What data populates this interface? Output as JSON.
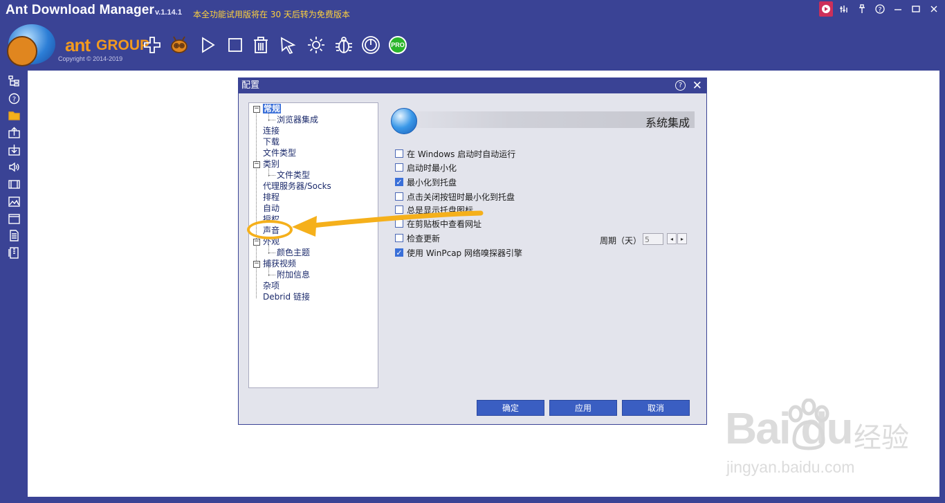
{
  "app": {
    "title": "Ant Download Manager",
    "version": "v.1.14.1",
    "trial_notice": "本全功能试用版将在 30 天后转为免费版本",
    "logo_word": "ant",
    "logo_group": "GROUP",
    "copyright": "Copyright © 2014-2019"
  },
  "window_controls": [
    "record-icon",
    "equalizer-icon",
    "pin-icon",
    "help-icon",
    "minimize-icon",
    "maximize-icon",
    "close-icon"
  ],
  "toolbar": {
    "pro_badge": "PRO",
    "buttons": [
      "add-icon",
      "ant-icon",
      "play-icon",
      "stop-icon",
      "delete-icon",
      "pointer-icon",
      "settings-icon",
      "bug-icon",
      "power-icon",
      "pro-icon"
    ]
  },
  "sidebar": [
    "tree-icon",
    "help-icon",
    "folder-icon",
    "upload-icon",
    "download-icon",
    "audio-icon",
    "video-icon",
    "image-icon",
    "window-icon",
    "document-icon",
    "archive-icon"
  ],
  "dialog": {
    "title": "配置",
    "tree": [
      {
        "label": "常规",
        "level": 0,
        "expander": "−",
        "selected": true
      },
      {
        "label": "浏览器集成",
        "level": 1
      },
      {
        "label": "连接",
        "level": 0
      },
      {
        "label": "下载",
        "level": 0
      },
      {
        "label": "文件类型",
        "level": 0
      },
      {
        "label": "类别",
        "level": 0,
        "expander": "−"
      },
      {
        "label": "文件类型",
        "level": 1
      },
      {
        "label": "代理服务器/Socks",
        "level": 0
      },
      {
        "label": "排程",
        "level": 0
      },
      {
        "label": "自动",
        "level": 0
      },
      {
        "label": "授权",
        "level": 0
      },
      {
        "label": "声音",
        "level": 0
      },
      {
        "label": "外观",
        "level": 0,
        "expander": "−"
      },
      {
        "label": "颜色主题",
        "level": 1
      },
      {
        "label": "捕获视频",
        "level": 0,
        "expander": "−"
      },
      {
        "label": "附加信息",
        "level": 1
      },
      {
        "label": "杂项",
        "level": 0
      },
      {
        "label": "Debrid 链接",
        "level": 0
      }
    ],
    "section_title": "系统集成",
    "options": [
      {
        "label": "在 Windows 启动时自动运行",
        "checked": false
      },
      {
        "label": "启动时最小化",
        "checked": false
      },
      {
        "label": "最小化到托盘",
        "checked": true
      },
      {
        "label": "点击关闭按钮时最小化到托盘",
        "checked": false
      },
      {
        "label": "总是显示托盘图标",
        "checked": false
      },
      {
        "label": "在剪贴板中查看网址",
        "checked": false
      },
      {
        "label": "检查更新",
        "checked": false
      },
      {
        "label": "使用 WinPcap 网络嗅探器引擎",
        "checked": true
      }
    ],
    "period_label": "周期（天）",
    "period_value": "5",
    "buttons": {
      "ok": "确定",
      "apply": "应用",
      "cancel": "取消"
    }
  },
  "watermark": {
    "brand": "Bai du",
    "site": "jingyan.baidu.com",
    "cn": "经验"
  },
  "colors": {
    "accent": "#3a4395",
    "selection": "#3a6fd8",
    "annotation": "#f5b01b",
    "trial_text": "#ffd23c"
  }
}
